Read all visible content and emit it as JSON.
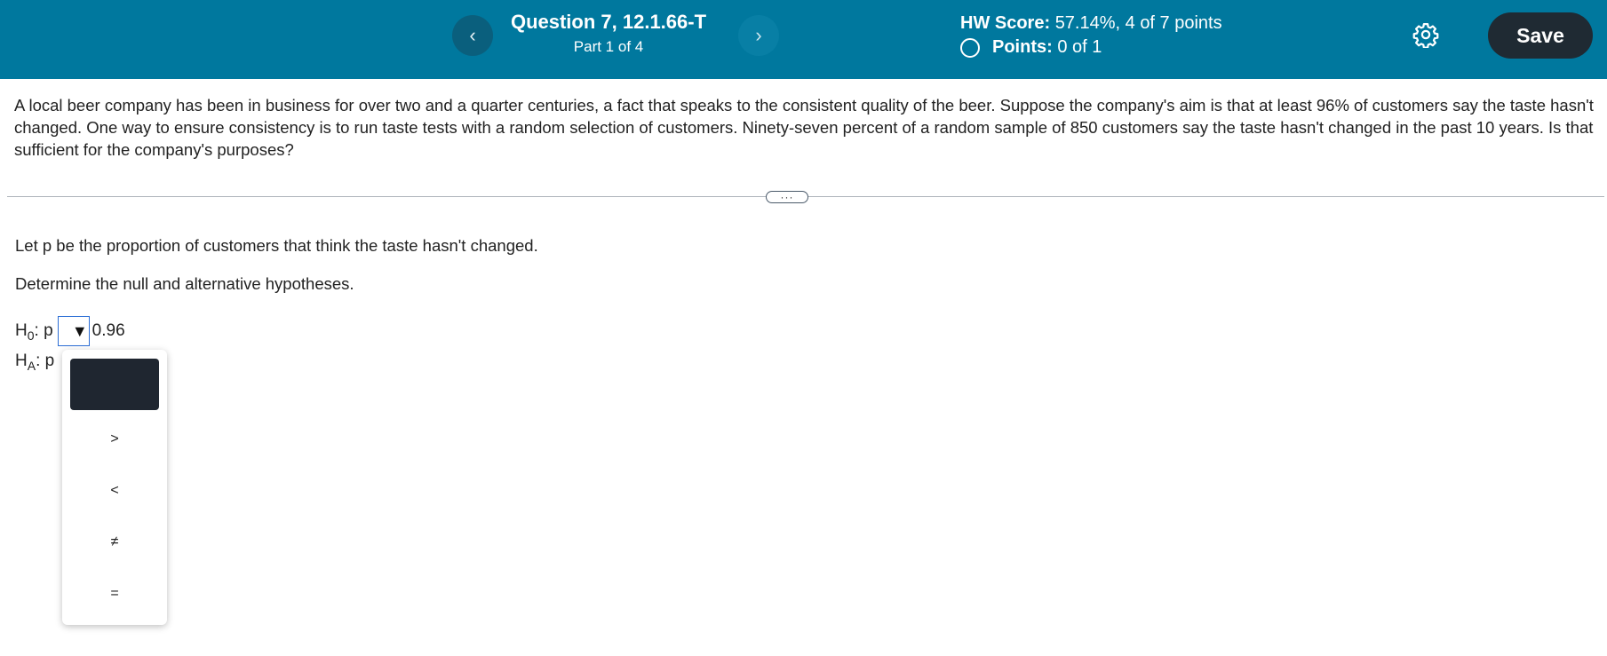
{
  "header": {
    "prev_icon": "chevron-left-icon",
    "prev_glyph": "‹",
    "question_title": "Question 7, 12.1.66-T",
    "question_part": "Part 1 of 4",
    "next_icon": "chevron-right-icon",
    "next_glyph": "›",
    "hw_score_label": "HW Score:",
    "hw_score_value": "57.14%, 4 of 7 points",
    "points_label": "Points:",
    "points_value": "0 of 1",
    "save_label": "Save",
    "settings_icon": "gear-icon",
    "bg_color": "#00789e"
  },
  "problem": {
    "text": "A local beer company has been in business for over two and a quarter centuries, a fact that speaks to the consistent quality of the beer. Suppose the company's aim is that at least 96% of customers say the taste hasn't changed. One way to ensure consistency is to run taste tests with a random selection of customers. Ninety-seven percent of a random sample of 850 customers say the taste hasn't changed in the past 10 years. Is that sufficient for the company's purposes?"
  },
  "expand_label": "···",
  "question": {
    "let_text": "Let p be the proportion of customers that think the taste hasn't changed.",
    "determine_text": "Determine the null and alternative hypotheses.",
    "h0": {
      "h": "H",
      "sub": "0",
      "rest": ": p",
      "value": "0.96"
    },
    "ha": {
      "h": "H",
      "sub": "A",
      "rest": ": p"
    },
    "dropdown_arrow": "▼"
  },
  "dropdown_menu": {
    "options": [
      ">",
      "<",
      "≠",
      "="
    ]
  }
}
